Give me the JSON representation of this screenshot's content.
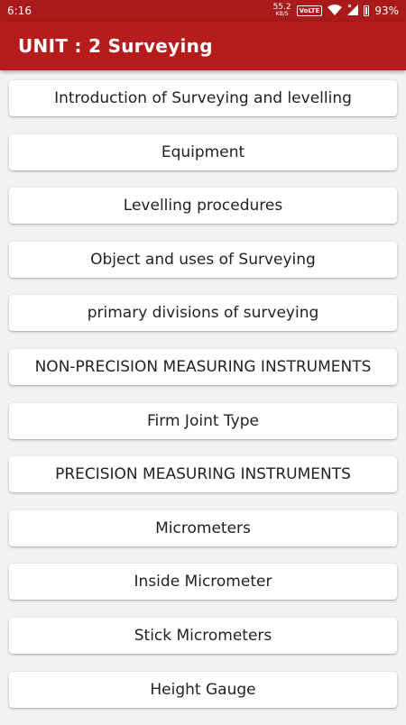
{
  "status_bar": {
    "time": "6:16",
    "net_speed_value": "55.2",
    "net_speed_unit": "KB/S",
    "volte": "VoLTE",
    "battery": "93%",
    "icons": [
      "wifi-icon",
      "signal-icon",
      "battery-icon"
    ]
  },
  "app_bar": {
    "title": "UNIT : 2  Surveying"
  },
  "items": [
    {
      "label": "Introduction of Surveying and levelling"
    },
    {
      "label": "Equipment"
    },
    {
      "label": "Levelling procedures"
    },
    {
      "label": "Object and uses of Surveying"
    },
    {
      "label": "primary divisions of surveying"
    },
    {
      "label": "NON-PRECISION MEASURING INSTRUMENTS"
    },
    {
      "label": "Firm Joint Type"
    },
    {
      "label": "PRECISION MEASURING INSTRUMENTS"
    },
    {
      "label": "Micrometers"
    },
    {
      "label": "Inside Micrometer"
    },
    {
      "label": "Stick Micrometers"
    },
    {
      "label": "Height Gauge"
    }
  ],
  "colors": {
    "status_bar": "#a91a1a",
    "app_bar": "#b71c1c",
    "background": "#f2f2f2",
    "card": "#ffffff",
    "text": "#222222"
  }
}
